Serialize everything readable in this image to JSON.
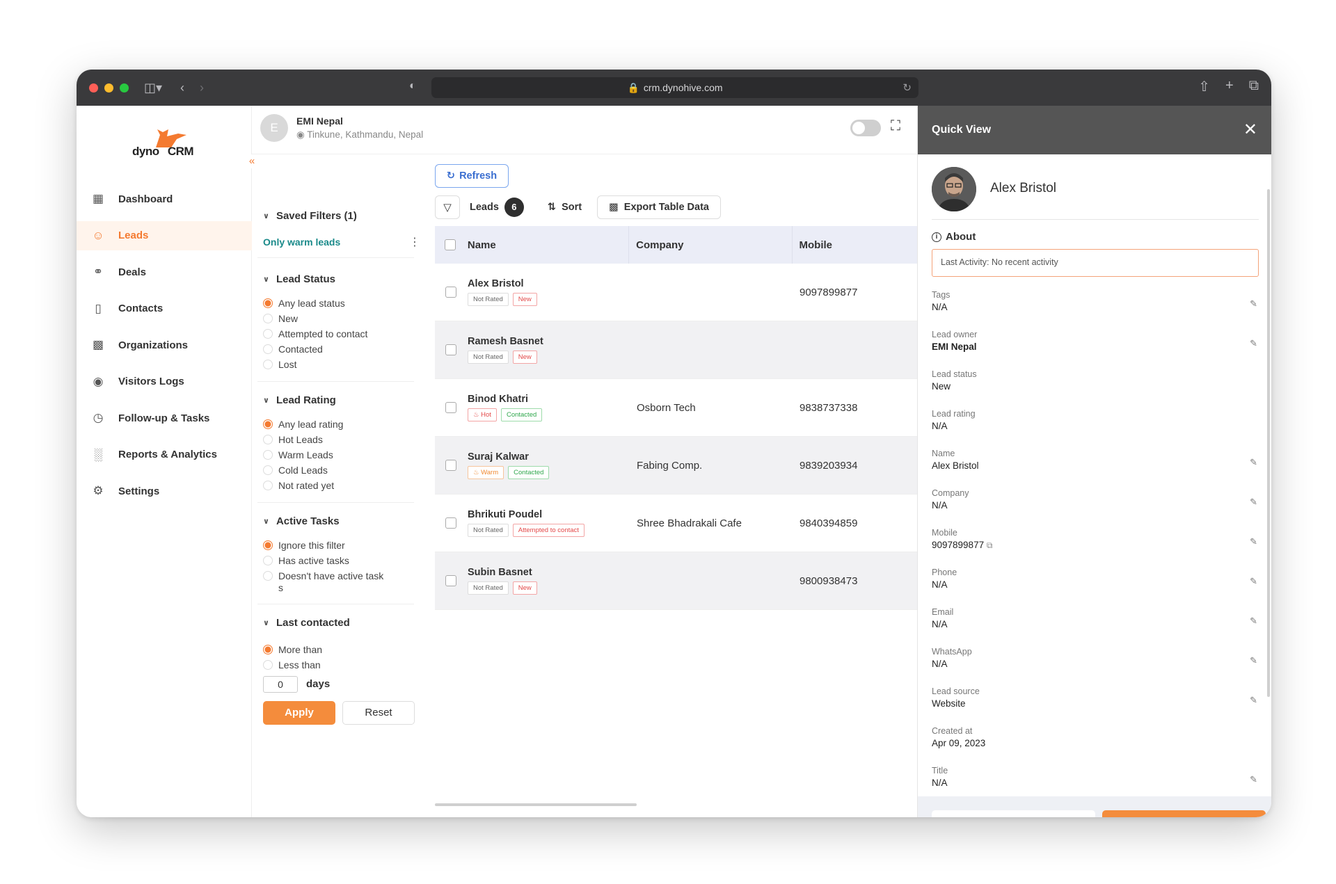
{
  "browser": {
    "url": "crm.dynohive.com"
  },
  "sidebar": {
    "logo_left": "dyno",
    "logo_right": "CRM",
    "items": [
      {
        "label": "Dashboard",
        "icon": "grid-icon"
      },
      {
        "label": "Leads",
        "icon": "users-icon"
      },
      {
        "label": "Deals",
        "icon": "handshake-icon"
      },
      {
        "label": "Contacts",
        "icon": "contact-book-icon"
      },
      {
        "label": "Organizations",
        "icon": "building-icon"
      },
      {
        "label": "Visitors Logs",
        "icon": "location-pin-icon"
      },
      {
        "label": "Follow-up & Tasks",
        "icon": "clock-icon"
      },
      {
        "label": "Reports & Analytics",
        "icon": "bar-chart-icon"
      },
      {
        "label": "Settings",
        "icon": "gear-icon"
      }
    ],
    "active_color": "#f47a30"
  },
  "header": {
    "avatar_initial": "E",
    "org_name": "EMI Nepal",
    "org_location": "Tinkune, Kathmandu, Nepal"
  },
  "filters": {
    "saved_filters": "Saved Filters (1)",
    "saved_item": "Only warm leads",
    "lead_status": {
      "title": "Lead Status",
      "options": [
        "Any lead status",
        "New",
        "Attempted to contact",
        "Contacted",
        "Lost"
      ]
    },
    "lead_rating": {
      "title": "Lead Rating",
      "options": [
        "Any lead rating",
        "Hot Leads",
        "Warm Leads",
        "Cold Leads",
        "Not rated yet"
      ]
    },
    "active_tasks": {
      "title": "Active Tasks",
      "options": [
        "Ignore this filter",
        "Has active tasks",
        "Doesn't have active task",
        "s"
      ]
    },
    "last_contacted": {
      "title": "Last contacted",
      "options": [
        "More than",
        "Less than"
      ],
      "days_value": "0",
      "days_label": "days"
    },
    "apply_label": "Apply",
    "reset_label": "Reset"
  },
  "toolbar": {
    "refresh": "Refresh",
    "leads_label": "Leads",
    "leads_count": "6",
    "sort": "Sort",
    "export": "Export Table Data"
  },
  "table": {
    "columns": [
      "Name",
      "Company",
      "Mobile"
    ],
    "rows": [
      {
        "name": "Alex Bristol",
        "tags": [
          "Not Rated",
          "New"
        ],
        "company": "",
        "mobile": "9097899877"
      },
      {
        "name": "Ramesh Basnet",
        "tags": [
          "Not Rated",
          "New"
        ],
        "company": "",
        "mobile": ""
      },
      {
        "name": "Binod Khatri",
        "tags": [
          "Hot",
          "Contacted"
        ],
        "company": "Osborn Tech",
        "mobile": "9838737338"
      },
      {
        "name": "Suraj Kalwar",
        "tags": [
          "Warm",
          "Contacted"
        ],
        "company": "Fabing Comp.",
        "mobile": "9839203934"
      },
      {
        "name": "Bhrikuti Poudel",
        "tags": [
          "Not Rated",
          "Attempted to contact"
        ],
        "company": "Shree Bhadrakali Cafe",
        "mobile": "9840394859"
      },
      {
        "name": "Subin Basnet",
        "tags": [
          "Not Rated",
          "New"
        ],
        "company": "",
        "mobile": "9800938473"
      }
    ]
  },
  "quick_view": {
    "title": "Quick View",
    "name": "Alex Bristol",
    "about": "About",
    "last_activity": "Last Activity: No recent activity",
    "fields": [
      {
        "label": "Tags",
        "value": "N/A"
      },
      {
        "label": "Lead owner",
        "value": "EMI Nepal"
      },
      {
        "label": "Lead status",
        "value": "New"
      },
      {
        "label": "Lead rating",
        "value": "N/A"
      },
      {
        "label": "Name",
        "value": "Alex Bristol"
      },
      {
        "label": "Company",
        "value": "N/A"
      },
      {
        "label": "Mobile",
        "value": "9097899877"
      },
      {
        "label": "Phone",
        "value": "N/A"
      },
      {
        "label": "Email",
        "value": "N/A"
      },
      {
        "label": "WhatsApp",
        "value": "N/A"
      },
      {
        "label": "Lead source",
        "value": "Website"
      },
      {
        "label": "Created at",
        "value": "Apr 09, 2023"
      },
      {
        "label": "Title",
        "value": "N/A"
      }
    ]
  }
}
